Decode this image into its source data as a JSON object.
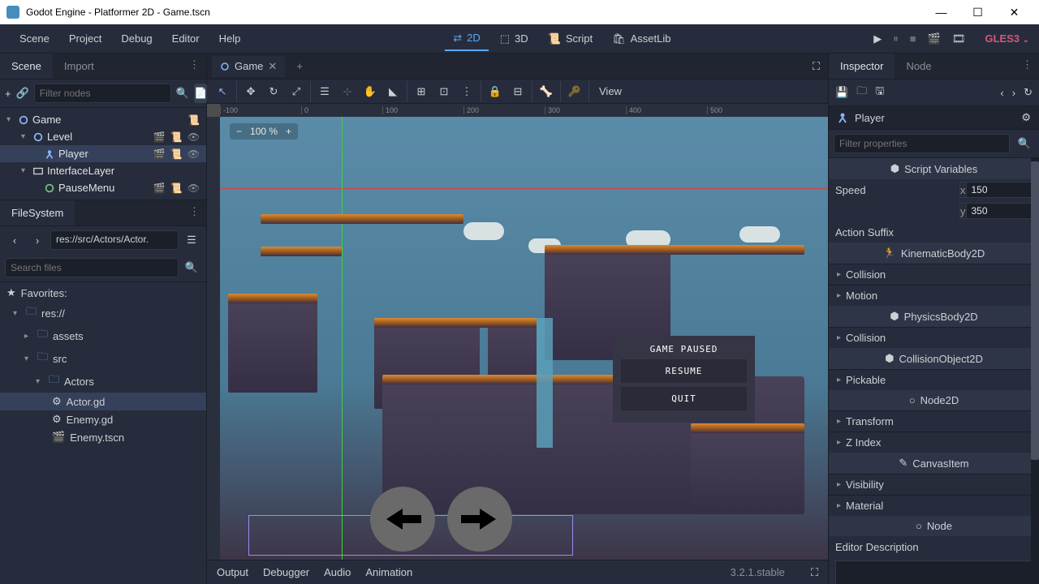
{
  "window": {
    "title": "Godot Engine - Platformer 2D - Game.tscn"
  },
  "menus": {
    "scene": "Scene",
    "project": "Project",
    "debug": "Debug",
    "editor": "Editor",
    "help": "Help"
  },
  "modes": {
    "m2d": "2D",
    "m3d": "3D",
    "script": "Script",
    "assetlib": "AssetLib"
  },
  "gles": "GLES3",
  "left_tabs": {
    "scene": "Scene",
    "import": "Import"
  },
  "scene_filter_ph": "Filter nodes",
  "scene_tree": {
    "root": "Game",
    "level": "Level",
    "player": "Player",
    "interface": "InterfaceLayer",
    "pause": "PauseMenu"
  },
  "fs": {
    "title": "FileSystem",
    "path": "res://src/Actors/Actor.",
    "search_ph": "Search files",
    "favorites": "Favorites:",
    "root": "res://",
    "assets": "assets",
    "src": "src",
    "actors": "Actors",
    "actor_gd": "Actor.gd",
    "enemy_gd": "Enemy.gd",
    "enemy_tscn": "Enemy.tscn"
  },
  "viewport": {
    "tab": "Game",
    "zoom": "100 %",
    "view_label": "View",
    "ruler_marks": [
      "-100",
      "0",
      "100",
      "200",
      "300",
      "400",
      "500"
    ],
    "pause_title": "GAME PAUSED",
    "resume": "RESUME",
    "quit": "QUIT"
  },
  "bottom": {
    "output": "Output",
    "debugger": "Debugger",
    "audio": "Audio",
    "animation": "Animation",
    "version": "3.2.1.stable"
  },
  "inspector": {
    "tab": "Inspector",
    "tab_node": "Node",
    "object": "Player",
    "filter_ph": "Filter properties",
    "script_vars": "Script Variables",
    "speed_label": "Speed",
    "speed_x": "150",
    "speed_y": "350",
    "action_suffix": "Action Suffix",
    "kinematic": "KinematicBody2D",
    "collision": "Collision",
    "motion": "Motion",
    "physics": "PhysicsBody2D",
    "collobj": "CollisionObject2D",
    "pickable": "Pickable",
    "node2d": "Node2D",
    "transform": "Transform",
    "zindex": "Z Index",
    "canvasitem": "CanvasItem",
    "visibility": "Visibility",
    "material": "Material",
    "node_cls": "Node",
    "editor_desc": "Editor Description"
  }
}
